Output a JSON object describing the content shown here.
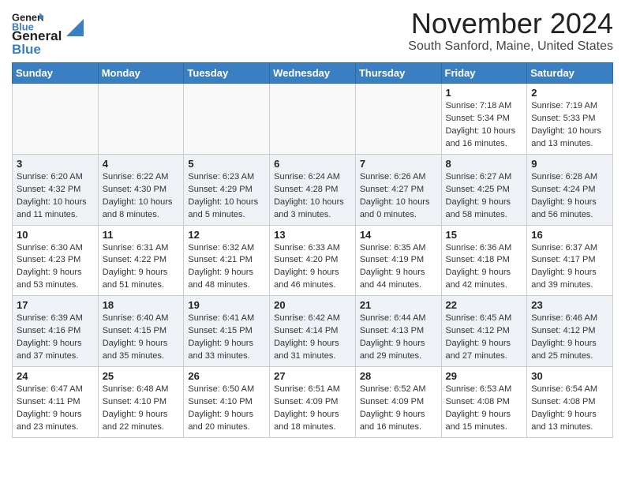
{
  "header": {
    "logo_line1": "General",
    "logo_line2": "Blue",
    "month": "November 2024",
    "location": "South Sanford, Maine, United States"
  },
  "weekdays": [
    "Sunday",
    "Monday",
    "Tuesday",
    "Wednesday",
    "Thursday",
    "Friday",
    "Saturday"
  ],
  "weeks": [
    [
      {
        "day": "",
        "info": ""
      },
      {
        "day": "",
        "info": ""
      },
      {
        "day": "",
        "info": ""
      },
      {
        "day": "",
        "info": ""
      },
      {
        "day": "",
        "info": ""
      },
      {
        "day": "1",
        "info": "Sunrise: 7:18 AM\nSunset: 5:34 PM\nDaylight: 10 hours\nand 16 minutes."
      },
      {
        "day": "2",
        "info": "Sunrise: 7:19 AM\nSunset: 5:33 PM\nDaylight: 10 hours\nand 13 minutes."
      }
    ],
    [
      {
        "day": "3",
        "info": "Sunrise: 6:20 AM\nSunset: 4:32 PM\nDaylight: 10 hours\nand 11 minutes."
      },
      {
        "day": "4",
        "info": "Sunrise: 6:22 AM\nSunset: 4:30 PM\nDaylight: 10 hours\nand 8 minutes."
      },
      {
        "day": "5",
        "info": "Sunrise: 6:23 AM\nSunset: 4:29 PM\nDaylight: 10 hours\nand 5 minutes."
      },
      {
        "day": "6",
        "info": "Sunrise: 6:24 AM\nSunset: 4:28 PM\nDaylight: 10 hours\nand 3 minutes."
      },
      {
        "day": "7",
        "info": "Sunrise: 6:26 AM\nSunset: 4:27 PM\nDaylight: 10 hours\nand 0 minutes."
      },
      {
        "day": "8",
        "info": "Sunrise: 6:27 AM\nSunset: 4:25 PM\nDaylight: 9 hours\nand 58 minutes."
      },
      {
        "day": "9",
        "info": "Sunrise: 6:28 AM\nSunset: 4:24 PM\nDaylight: 9 hours\nand 56 minutes."
      }
    ],
    [
      {
        "day": "10",
        "info": "Sunrise: 6:30 AM\nSunset: 4:23 PM\nDaylight: 9 hours\nand 53 minutes."
      },
      {
        "day": "11",
        "info": "Sunrise: 6:31 AM\nSunset: 4:22 PM\nDaylight: 9 hours\nand 51 minutes."
      },
      {
        "day": "12",
        "info": "Sunrise: 6:32 AM\nSunset: 4:21 PM\nDaylight: 9 hours\nand 48 minutes."
      },
      {
        "day": "13",
        "info": "Sunrise: 6:33 AM\nSunset: 4:20 PM\nDaylight: 9 hours\nand 46 minutes."
      },
      {
        "day": "14",
        "info": "Sunrise: 6:35 AM\nSunset: 4:19 PM\nDaylight: 9 hours\nand 44 minutes."
      },
      {
        "day": "15",
        "info": "Sunrise: 6:36 AM\nSunset: 4:18 PM\nDaylight: 9 hours\nand 42 minutes."
      },
      {
        "day": "16",
        "info": "Sunrise: 6:37 AM\nSunset: 4:17 PM\nDaylight: 9 hours\nand 39 minutes."
      }
    ],
    [
      {
        "day": "17",
        "info": "Sunrise: 6:39 AM\nSunset: 4:16 PM\nDaylight: 9 hours\nand 37 minutes."
      },
      {
        "day": "18",
        "info": "Sunrise: 6:40 AM\nSunset: 4:15 PM\nDaylight: 9 hours\nand 35 minutes."
      },
      {
        "day": "19",
        "info": "Sunrise: 6:41 AM\nSunset: 4:15 PM\nDaylight: 9 hours\nand 33 minutes."
      },
      {
        "day": "20",
        "info": "Sunrise: 6:42 AM\nSunset: 4:14 PM\nDaylight: 9 hours\nand 31 minutes."
      },
      {
        "day": "21",
        "info": "Sunrise: 6:44 AM\nSunset: 4:13 PM\nDaylight: 9 hours\nand 29 minutes."
      },
      {
        "day": "22",
        "info": "Sunrise: 6:45 AM\nSunset: 4:12 PM\nDaylight: 9 hours\nand 27 minutes."
      },
      {
        "day": "23",
        "info": "Sunrise: 6:46 AM\nSunset: 4:12 PM\nDaylight: 9 hours\nand 25 minutes."
      }
    ],
    [
      {
        "day": "24",
        "info": "Sunrise: 6:47 AM\nSunset: 4:11 PM\nDaylight: 9 hours\nand 23 minutes."
      },
      {
        "day": "25",
        "info": "Sunrise: 6:48 AM\nSunset: 4:10 PM\nDaylight: 9 hours\nand 22 minutes."
      },
      {
        "day": "26",
        "info": "Sunrise: 6:50 AM\nSunset: 4:10 PM\nDaylight: 9 hours\nand 20 minutes."
      },
      {
        "day": "27",
        "info": "Sunrise: 6:51 AM\nSunset: 4:09 PM\nDaylight: 9 hours\nand 18 minutes."
      },
      {
        "day": "28",
        "info": "Sunrise: 6:52 AM\nSunset: 4:09 PM\nDaylight: 9 hours\nand 16 minutes."
      },
      {
        "day": "29",
        "info": "Sunrise: 6:53 AM\nSunset: 4:08 PM\nDaylight: 9 hours\nand 15 minutes."
      },
      {
        "day": "30",
        "info": "Sunrise: 6:54 AM\nSunset: 4:08 PM\nDaylight: 9 hours\nand 13 minutes."
      }
    ]
  ]
}
